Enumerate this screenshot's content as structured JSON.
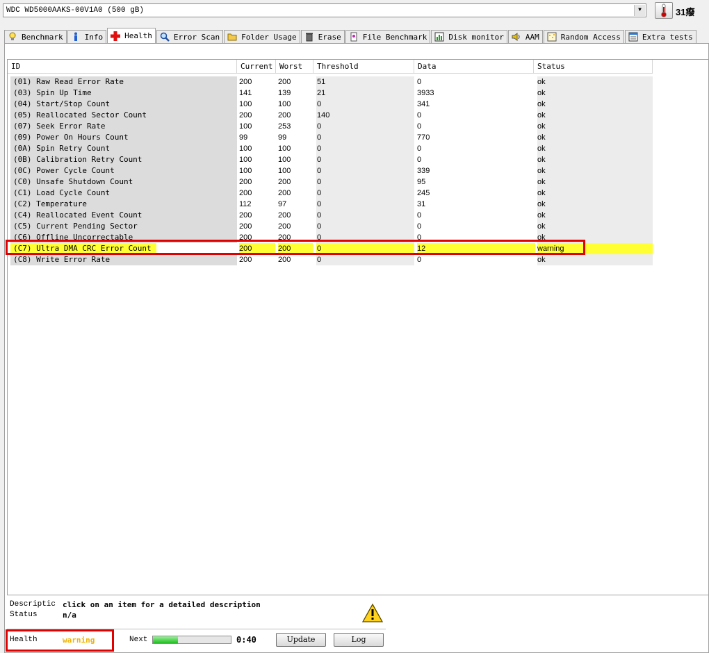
{
  "drive": {
    "selected": "WDC WD5000AAKS-00V1A0 (500 gB)",
    "temperature": "31癈"
  },
  "tabs": [
    {
      "label": "Benchmark",
      "icon": "lightbulb-icon"
    },
    {
      "label": "Info",
      "icon": "info-icon"
    },
    {
      "label": "Health",
      "icon": "red-cross-icon",
      "active": true
    },
    {
      "label": "Error Scan",
      "icon": "magnifier-icon"
    },
    {
      "label": "Folder Usage",
      "icon": "folder-icon"
    },
    {
      "label": "Erase",
      "icon": "trash-icon"
    },
    {
      "label": "File Benchmark",
      "icon": "file-benchmark-icon"
    },
    {
      "label": "Disk monitor",
      "icon": "disk-monitor-icon"
    },
    {
      "label": "AAM",
      "icon": "speaker-icon"
    },
    {
      "label": "Random Access",
      "icon": "random-access-icon"
    },
    {
      "label": "Extra tests",
      "icon": "extra-tests-icon"
    }
  ],
  "table": {
    "columns": [
      "ID",
      "Current",
      "Worst",
      "Threshold",
      "Data",
      "Status"
    ],
    "rows": [
      {
        "id": "(01) Raw Read Error Rate",
        "current": "200",
        "worst": "200",
        "threshold": "51",
        "data": "0",
        "status": "ok"
      },
      {
        "id": "(03) Spin Up Time",
        "current": "141",
        "worst": "139",
        "threshold": "21",
        "data": "3933",
        "status": "ok"
      },
      {
        "id": "(04) Start/Stop Count",
        "current": "100",
        "worst": "100",
        "threshold": "0",
        "data": "341",
        "status": "ok"
      },
      {
        "id": "(05) Reallocated Sector Count",
        "current": "200",
        "worst": "200",
        "threshold": "140",
        "data": "0",
        "status": "ok"
      },
      {
        "id": "(07) Seek Error Rate",
        "current": "100",
        "worst": "253",
        "threshold": "0",
        "data": "0",
        "status": "ok"
      },
      {
        "id": "(09) Power On Hours Count",
        "current": "99",
        "worst": "99",
        "threshold": "0",
        "data": "770",
        "status": "ok"
      },
      {
        "id": "(0A) Spin Retry Count",
        "current": "100",
        "worst": "100",
        "threshold": "0",
        "data": "0",
        "status": "ok"
      },
      {
        "id": "(0B) Calibration Retry Count",
        "current": "100",
        "worst": "100",
        "threshold": "0",
        "data": "0",
        "status": "ok"
      },
      {
        "id": "(0C) Power Cycle Count",
        "current": "100",
        "worst": "100",
        "threshold": "0",
        "data": "339",
        "status": "ok"
      },
      {
        "id": "(C0) Unsafe Shutdown Count",
        "current": "200",
        "worst": "200",
        "threshold": "0",
        "data": "95",
        "status": "ok"
      },
      {
        "id": "(C1) Load Cycle Count",
        "current": "200",
        "worst": "200",
        "threshold": "0",
        "data": "245",
        "status": "ok"
      },
      {
        "id": "(C2) Temperature",
        "current": "112",
        "worst": "97",
        "threshold": "0",
        "data": "31",
        "status": "ok"
      },
      {
        "id": "(C4) Reallocated Event Count",
        "current": "200",
        "worst": "200",
        "threshold": "0",
        "data": "0",
        "status": "ok"
      },
      {
        "id": "(C5) Current Pending Sector",
        "current": "200",
        "worst": "200",
        "threshold": "0",
        "data": "0",
        "status": "ok"
      },
      {
        "id": "(C6) Offline Uncorrectable",
        "current": "200",
        "worst": "200",
        "threshold": "0",
        "data": "0",
        "status": "ok"
      },
      {
        "id": "(C7) Ultra DMA CRC Error Count",
        "current": "200",
        "worst": "200",
        "threshold": "0",
        "data": "12",
        "status": "warning",
        "warning": true
      },
      {
        "id": "(C8) Write Error Rate",
        "current": "200",
        "worst": "200",
        "threshold": "0",
        "data": "0",
        "status": "ok"
      }
    ]
  },
  "details": {
    "description_label": "Descriptic",
    "description_value": "click on an item for a detailed description",
    "status_label": "Status",
    "status_value": "n/a"
  },
  "footer": {
    "health_label": "Health",
    "health_value": "warning",
    "health_color": "#f0b400",
    "next_label": "Next",
    "countdown": "0:40",
    "progress_fraction": 0.32,
    "update_label": "Update",
    "log_label": "Log"
  }
}
